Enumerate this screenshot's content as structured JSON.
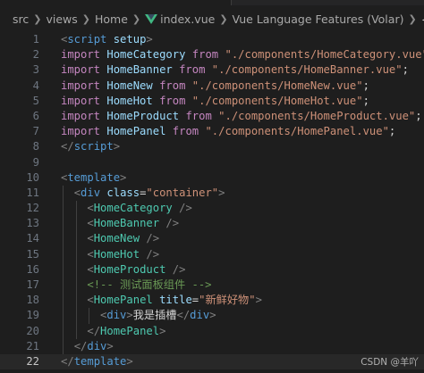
{
  "breadcrumb": {
    "items": [
      "src",
      "views",
      "Home",
      "index.vue",
      "Vue Language Features (Volar)",
      "template"
    ]
  },
  "editor": {
    "active_line": 22,
    "lines": [
      [
        [
          "punct",
          "<"
        ],
        [
          "tag",
          "script"
        ],
        [
          "plain",
          " "
        ],
        [
          "attr",
          "setup"
        ],
        [
          "punct",
          ">"
        ]
      ],
      [
        [
          "kw",
          "import"
        ],
        [
          "plain",
          " "
        ],
        [
          "var",
          "HomeCategory"
        ],
        [
          "plain",
          " "
        ],
        [
          "kw",
          "from"
        ],
        [
          "plain",
          " "
        ],
        [
          "str",
          "\"./components/HomeCategory.vue\""
        ],
        [
          "plain",
          ";"
        ]
      ],
      [
        [
          "kw",
          "import"
        ],
        [
          "plain",
          " "
        ],
        [
          "var",
          "HomeBanner"
        ],
        [
          "plain",
          " "
        ],
        [
          "kw",
          "from"
        ],
        [
          "plain",
          " "
        ],
        [
          "str",
          "\"./components/HomeBanner.vue\""
        ],
        [
          "plain",
          ";"
        ]
      ],
      [
        [
          "kw",
          "import"
        ],
        [
          "plain",
          " "
        ],
        [
          "var",
          "HomeNew"
        ],
        [
          "plain",
          " "
        ],
        [
          "kw",
          "from"
        ],
        [
          "plain",
          " "
        ],
        [
          "str",
          "\"./components/HomeNew.vue\""
        ],
        [
          "plain",
          ";"
        ]
      ],
      [
        [
          "kw",
          "import"
        ],
        [
          "plain",
          " "
        ],
        [
          "var",
          "HomeHot"
        ],
        [
          "plain",
          " "
        ],
        [
          "kw",
          "from"
        ],
        [
          "plain",
          " "
        ],
        [
          "str",
          "\"./components/HomeHot.vue\""
        ],
        [
          "plain",
          ";"
        ]
      ],
      [
        [
          "kw",
          "import"
        ],
        [
          "plain",
          " "
        ],
        [
          "var",
          "HomeProduct"
        ],
        [
          "plain",
          " "
        ],
        [
          "kw",
          "from"
        ],
        [
          "plain",
          " "
        ],
        [
          "str",
          "\"./components/HomeProduct.vue\""
        ],
        [
          "plain",
          ";"
        ]
      ],
      [
        [
          "kw",
          "import"
        ],
        [
          "plain",
          " "
        ],
        [
          "var",
          "HomePanel"
        ],
        [
          "plain",
          " "
        ],
        [
          "kw",
          "from"
        ],
        [
          "plain",
          " "
        ],
        [
          "str",
          "\"./components/HomePanel.vue\""
        ],
        [
          "plain",
          ";"
        ]
      ],
      [
        [
          "punct",
          "</"
        ],
        [
          "tag",
          "script"
        ],
        [
          "punct",
          ">"
        ]
      ],
      [],
      [
        [
          "punct",
          "<"
        ],
        [
          "tag",
          "template"
        ],
        [
          "punct",
          ">"
        ]
      ],
      [
        [
          "plain",
          "  "
        ],
        [
          "punct",
          "<"
        ],
        [
          "tag",
          "div"
        ],
        [
          "plain",
          " "
        ],
        [
          "attr",
          "class"
        ],
        [
          "plain",
          "="
        ],
        [
          "str",
          "\"container\""
        ],
        [
          "punct",
          ">"
        ]
      ],
      [
        [
          "plain",
          "    "
        ],
        [
          "punct",
          "<"
        ],
        [
          "comp",
          "HomeCategory"
        ],
        [
          "plain",
          " "
        ],
        [
          "punct",
          "/>"
        ]
      ],
      [
        [
          "plain",
          "    "
        ],
        [
          "punct",
          "<"
        ],
        [
          "comp",
          "HomeBanner"
        ],
        [
          "plain",
          " "
        ],
        [
          "punct",
          "/>"
        ]
      ],
      [
        [
          "plain",
          "    "
        ],
        [
          "punct",
          "<"
        ],
        [
          "comp",
          "HomeNew"
        ],
        [
          "plain",
          " "
        ],
        [
          "punct",
          "/>"
        ]
      ],
      [
        [
          "plain",
          "    "
        ],
        [
          "punct",
          "<"
        ],
        [
          "comp",
          "HomeHot"
        ],
        [
          "plain",
          " "
        ],
        [
          "punct",
          "/>"
        ]
      ],
      [
        [
          "plain",
          "    "
        ],
        [
          "punct",
          "<"
        ],
        [
          "comp",
          "HomeProduct"
        ],
        [
          "plain",
          " "
        ],
        [
          "punct",
          "/>"
        ]
      ],
      [
        [
          "plain",
          "    "
        ],
        [
          "comment",
          "<!-- 测试面板组件 -->"
        ]
      ],
      [
        [
          "plain",
          "    "
        ],
        [
          "punct",
          "<"
        ],
        [
          "comp",
          "HomePanel"
        ],
        [
          "plain",
          " "
        ],
        [
          "attr",
          "title"
        ],
        [
          "plain",
          "="
        ],
        [
          "str",
          "\"新鲜好物\""
        ],
        [
          "punct",
          ">"
        ]
      ],
      [
        [
          "plain",
          "      "
        ],
        [
          "punct",
          "<"
        ],
        [
          "tag",
          "div"
        ],
        [
          "punct",
          ">"
        ],
        [
          "plain",
          "我是插槽"
        ],
        [
          "punct",
          "</"
        ],
        [
          "tag",
          "div"
        ],
        [
          "punct",
          ">"
        ]
      ],
      [
        [
          "plain",
          "    "
        ],
        [
          "punct",
          "</"
        ],
        [
          "comp",
          "HomePanel"
        ],
        [
          "punct",
          ">"
        ]
      ],
      [
        [
          "plain",
          "  "
        ],
        [
          "punct",
          "</"
        ],
        [
          "tag",
          "div"
        ],
        [
          "punct",
          ">"
        ]
      ],
      [
        [
          "punct",
          "</"
        ],
        [
          "tag",
          "template"
        ],
        [
          "punct",
          ">"
        ]
      ]
    ]
  },
  "watermark": "CSDN @羊吖",
  "colors": {
    "background": "#1e1e1e",
    "tag": "#569cd6",
    "attribute": "#9cdcfe",
    "string": "#ce9178",
    "keyword": "#c586c0",
    "component": "#4ec9b0",
    "comment": "#6a9955",
    "vue_icon": "#41b883"
  }
}
